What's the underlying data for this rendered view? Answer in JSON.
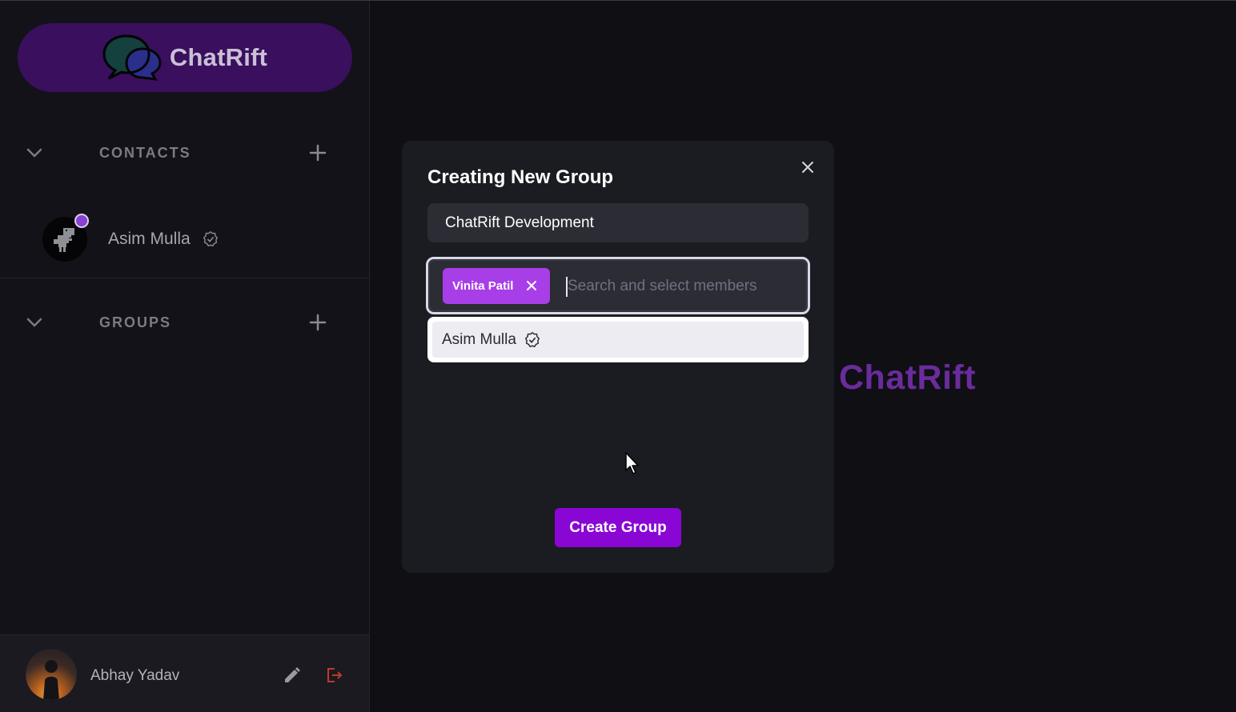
{
  "app": {
    "name": "ChatRift"
  },
  "sidebar": {
    "logo_text": "ChatRift",
    "contacts_section": {
      "label": "CONTACTS"
    },
    "contacts": [
      {
        "name": "Asim Mulla",
        "verified": true,
        "online": true
      }
    ],
    "groups_section": {
      "label": "GROUPS"
    },
    "current_user": {
      "name": "Abhay Yadav"
    }
  },
  "main": {
    "background_brand": "ChatRift"
  },
  "modal": {
    "title": "Creating New Group",
    "group_name_value": "ChatRift Development",
    "selected_members": [
      {
        "name": "Vinita Patil"
      }
    ],
    "member_search_placeholder": "Search and select members",
    "dropdown_options": [
      {
        "name": "Asim Mulla",
        "verified": true
      }
    ],
    "create_button_label": "Create Group"
  },
  "colors": {
    "accent_purple": "#8a06d4",
    "chip_purple": "#a83ee8",
    "logo_pill": "#3a0f5e",
    "brand_text": "#6a2c9c",
    "logout_red": "#c0392b"
  },
  "icons": [
    "chat-bubbles-logo-icon",
    "chevron-down-icon",
    "plus-icon",
    "verified-badge-icon",
    "close-icon",
    "edit-pencil-icon",
    "logout-icon",
    "mouse-pointer-icon"
  ]
}
